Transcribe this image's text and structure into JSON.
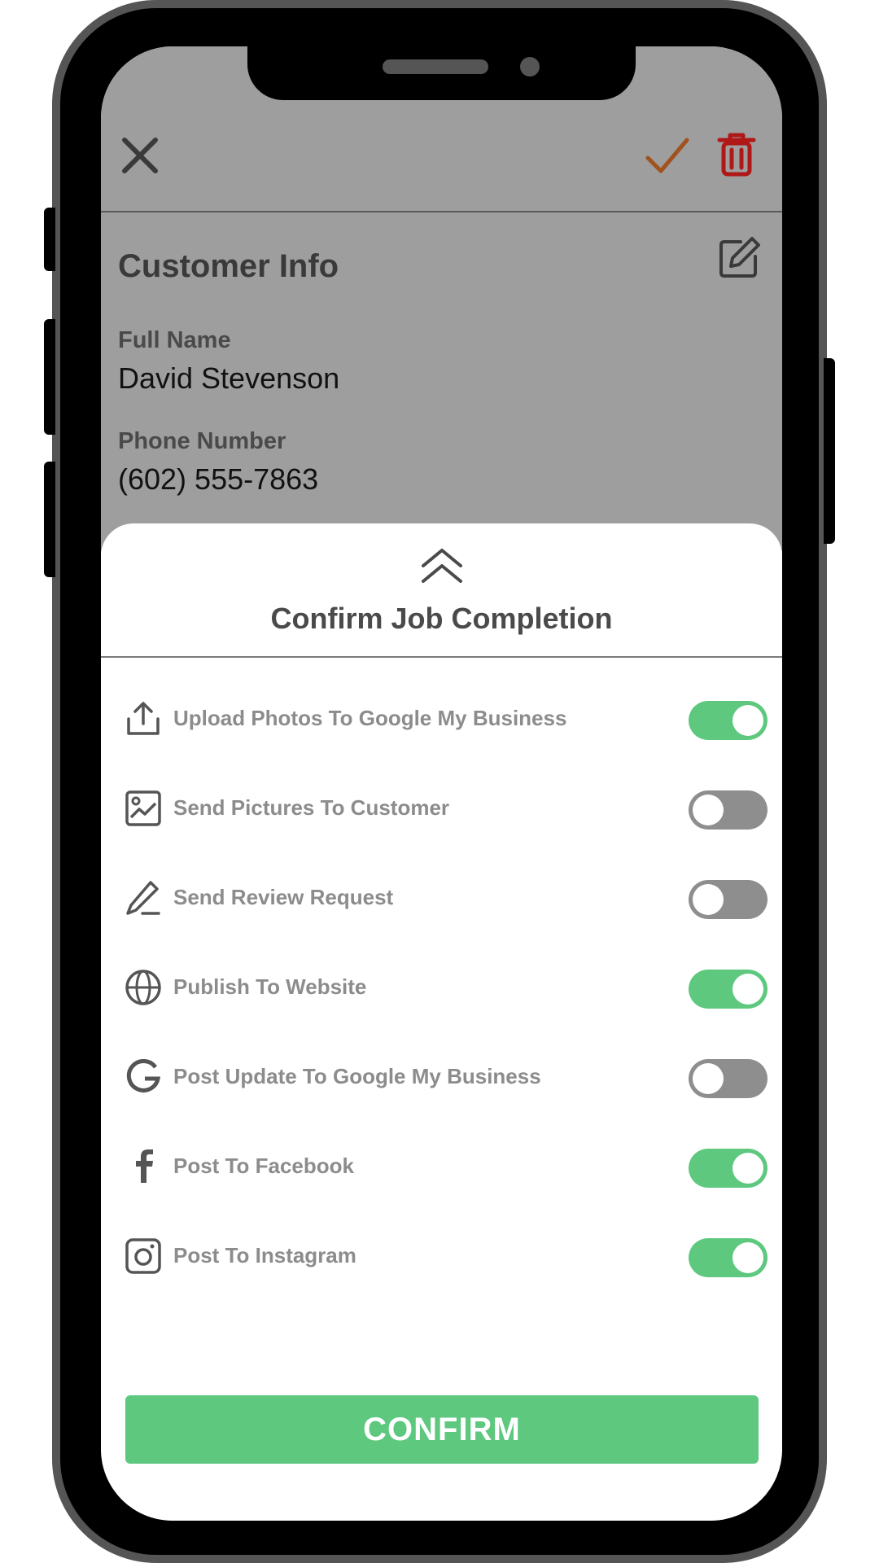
{
  "colors": {
    "dim_background": "#9e9e9e",
    "toggle_on": "#5ec87f",
    "toggle_off": "#8e8e8e",
    "check_accent": "#a0521f",
    "trash_accent": "#b01818",
    "confirm_button": "#5ec87f"
  },
  "toolbar": {
    "close_icon": "close-icon",
    "confirm_icon": "checkmark-icon",
    "delete_icon": "trash-icon"
  },
  "customer_info": {
    "title": "Customer Info",
    "edit_icon": "edit-icon",
    "full_name_label": "Full Name",
    "full_name_value": "David Stevenson",
    "phone_label": "Phone Number",
    "phone_value": "(602) 555-7863"
  },
  "sheet": {
    "handle_icon": "double-chevron-up-icon",
    "title": "Confirm Job Completion",
    "options": [
      {
        "label": "Upload Photos To Google My Business",
        "icon": "upload-icon",
        "enabled": true
      },
      {
        "label": "Send Pictures To Customer",
        "icon": "image-icon",
        "enabled": false
      },
      {
        "label": "Send Review Request",
        "icon": "pen-icon",
        "enabled": false
      },
      {
        "label": "Publish To Website",
        "icon": "globe-icon",
        "enabled": true
      },
      {
        "label": "Post Update To Google My Business",
        "icon": "google-icon",
        "enabled": false
      },
      {
        "label": "Post To Facebook",
        "icon": "facebook-icon",
        "enabled": true
      },
      {
        "label": "Post To Instagram",
        "icon": "instagram-icon",
        "enabled": true
      }
    ],
    "confirm_label": "CONFIRM"
  }
}
